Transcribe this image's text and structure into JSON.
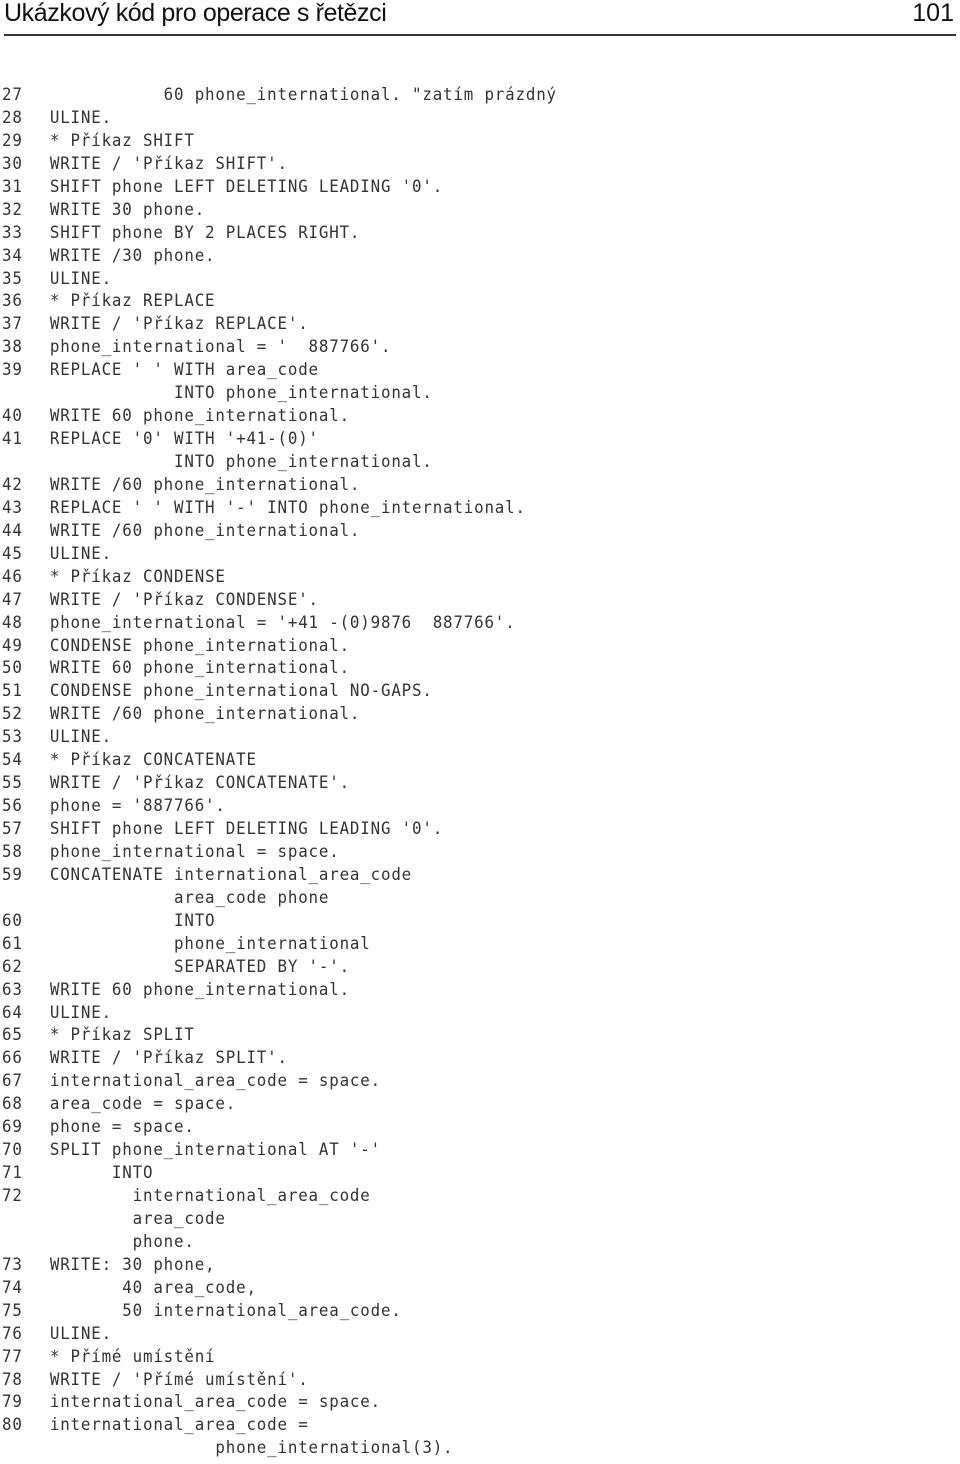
{
  "header": {
    "title": "Ukázkový kód pro operace s řetězci",
    "page_number": "101"
  },
  "code_lines": [
    {
      "num": "27",
      "text": "           60 phone_international. \"zatím prázdný"
    },
    {
      "num": "28",
      "text": "ULINE."
    },
    {
      "num": "29",
      "text": "* Příkaz SHIFT"
    },
    {
      "num": "30",
      "text": "WRITE / 'Příkaz SHIFT'."
    },
    {
      "num": "31",
      "text": "SHIFT phone LEFT DELETING LEADING '0'."
    },
    {
      "num": "32",
      "text": "WRITE 30 phone."
    },
    {
      "num": "33",
      "text": "SHIFT phone BY 2 PLACES RIGHT."
    },
    {
      "num": "34",
      "text": "WRITE /30 phone."
    },
    {
      "num": "35",
      "text": "ULINE."
    },
    {
      "num": "36",
      "text": "* Příkaz REPLACE"
    },
    {
      "num": "37",
      "text": "WRITE / 'Příkaz REPLACE'."
    },
    {
      "num": "38",
      "text": "phone_international = '  887766'."
    },
    {
      "num": "39",
      "text": "REPLACE ' ' WITH area_code"
    },
    {
      "num": "",
      "text": "            INTO phone_international."
    },
    {
      "num": "40",
      "text": "WRITE 60 phone_international."
    },
    {
      "num": "41",
      "text": "REPLACE '0' WITH '+41-(0)'"
    },
    {
      "num": "",
      "text": "            INTO phone_international."
    },
    {
      "num": "42",
      "text": "WRITE /60 phone_international."
    },
    {
      "num": "43",
      "text": "REPLACE ' ' WITH '-' INTO phone_international."
    },
    {
      "num": "44",
      "text": "WRITE /60 phone_international."
    },
    {
      "num": "45",
      "text": "ULINE."
    },
    {
      "num": "46",
      "text": "* Příkaz CONDENSE"
    },
    {
      "num": "47",
      "text": "WRITE / 'Příkaz CONDENSE'."
    },
    {
      "num": "48",
      "text": "phone_international = '+41 -(0)9876  887766'."
    },
    {
      "num": "49",
      "text": "CONDENSE phone_international."
    },
    {
      "num": "50",
      "text": "WRITE 60 phone_international."
    },
    {
      "num": "51",
      "text": "CONDENSE phone_international NO-GAPS."
    },
    {
      "num": "52",
      "text": "WRITE /60 phone_international."
    },
    {
      "num": "53",
      "text": "ULINE."
    },
    {
      "num": "54",
      "text": "* Příkaz CONCATENATE"
    },
    {
      "num": "55",
      "text": "WRITE / 'Příkaz CONCATENATE'."
    },
    {
      "num": "56",
      "text": "phone = '887766'."
    },
    {
      "num": "57",
      "text": "SHIFT phone LEFT DELETING LEADING '0'."
    },
    {
      "num": "58",
      "text": "phone_international = space."
    },
    {
      "num": "59",
      "text": "CONCATENATE international_area_code"
    },
    {
      "num": "",
      "text": "            area_code phone"
    },
    {
      "num": "60",
      "text": "            INTO"
    },
    {
      "num": "61",
      "text": "            phone_international"
    },
    {
      "num": "62",
      "text": "            SEPARATED BY '-'."
    },
    {
      "num": "63",
      "text": "WRITE 60 phone_international."
    },
    {
      "num": "64",
      "text": "ULINE."
    },
    {
      "num": "65",
      "text": "* Příkaz SPLIT"
    },
    {
      "num": "66",
      "text": "WRITE / 'Příkaz SPLIT'."
    },
    {
      "num": "67",
      "text": "international_area_code = space."
    },
    {
      "num": "68",
      "text": "area_code = space."
    },
    {
      "num": "69",
      "text": "phone = space."
    },
    {
      "num": "70",
      "text": "SPLIT phone_international AT '-'"
    },
    {
      "num": "71",
      "text": "      INTO"
    },
    {
      "num": "72",
      "text": "        international_area_code"
    },
    {
      "num": "",
      "text": "        area_code"
    },
    {
      "num": "",
      "text": "        phone."
    },
    {
      "num": "73",
      "text": "WRITE: 30 phone,"
    },
    {
      "num": "74",
      "text": "       40 area_code,"
    },
    {
      "num": "75",
      "text": "       50 international_area_code."
    },
    {
      "num": "76",
      "text": "ULINE."
    },
    {
      "num": "77",
      "text": "* Přímé umístění"
    },
    {
      "num": "78",
      "text": "WRITE / 'Přímé umístění'."
    },
    {
      "num": "79",
      "text": "international_area_code = space."
    },
    {
      "num": "80",
      "text": "international_area_code ="
    },
    {
      "num": "",
      "text": "                phone_international(3)."
    }
  ]
}
